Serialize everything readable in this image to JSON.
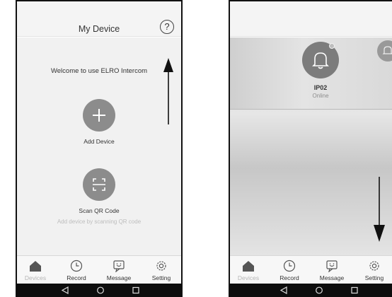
{
  "left_screen": {
    "header": {
      "title": "My Device",
      "help_glyph": "?"
    },
    "welcome_text": "Welcome to use ELRO Intercom",
    "add_device": {
      "label": "Add Device",
      "icon": "plus-icon"
    },
    "scan_qr": {
      "label": "Scan QR Code",
      "hint": "Add device by scanning QR code",
      "icon": "scan-frame-icon"
    }
  },
  "right_screen": {
    "device": {
      "name": "IP02",
      "status": "Online",
      "icon": "bell-icon"
    }
  },
  "tabbar": {
    "items": [
      {
        "label": "Devices",
        "icon": "home-icon",
        "active": true
      },
      {
        "label": "Record",
        "icon": "clock-icon",
        "active": false
      },
      {
        "label": "Message",
        "icon": "message-icon",
        "active": false
      },
      {
        "label": "Setting",
        "icon": "gear-icon",
        "active": false
      }
    ]
  },
  "navbar": {
    "items": [
      "back-icon",
      "home-circle-icon",
      "recents-icon"
    ]
  },
  "colors": {
    "icon_circle": "#8c8c8c",
    "background": "#f1f1f1",
    "tab_inactive": "#b5b5b5",
    "nav_background": "#0d0d0d"
  },
  "annotations": {
    "left_arrow": "up",
    "right_arrow": "down"
  }
}
